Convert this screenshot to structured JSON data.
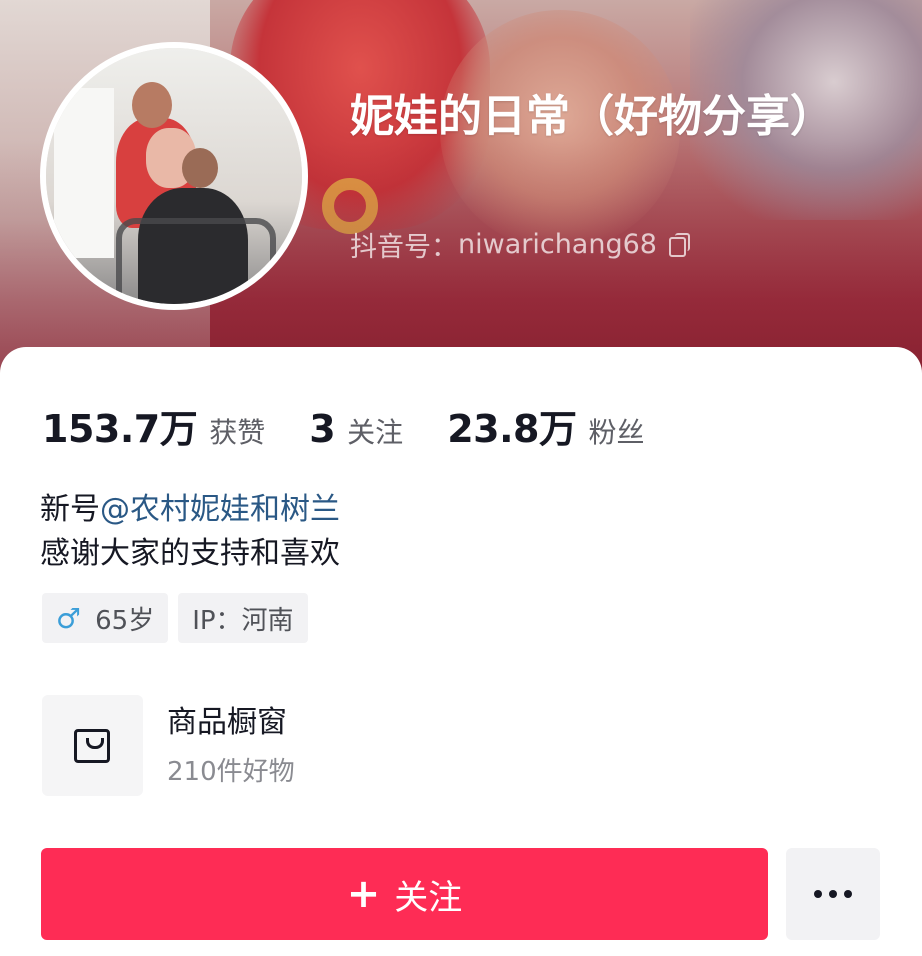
{
  "profile": {
    "nickname": "妮娃的日常（好物分享）",
    "douyin_id_label": "抖音号：",
    "douyin_id": "niwarichang68"
  },
  "stats": [
    {
      "value": "153.7万",
      "label": "获赞"
    },
    {
      "value": "3",
      "label": "关注"
    },
    {
      "value": "23.8万",
      "label": "粉丝"
    }
  ],
  "bio": {
    "line1_prefix": "新号",
    "line1_mention": "@农村妮娃和树兰",
    "line2": "感谢大家的支持和喜欢"
  },
  "tags": {
    "gender_icon": "♂",
    "age": "65岁",
    "ip": "IP：河南"
  },
  "shop": {
    "icon": "shopping-bag-icon",
    "title": "商品橱窗",
    "subtitle": "210件好物"
  },
  "actions": {
    "follow_icon": "+",
    "follow_label": "关注",
    "more_icon": "more-dots-icon"
  },
  "colors": {
    "accent": "#fe2c55",
    "mention": "#2a5885",
    "header_bg": "#9d3040"
  }
}
